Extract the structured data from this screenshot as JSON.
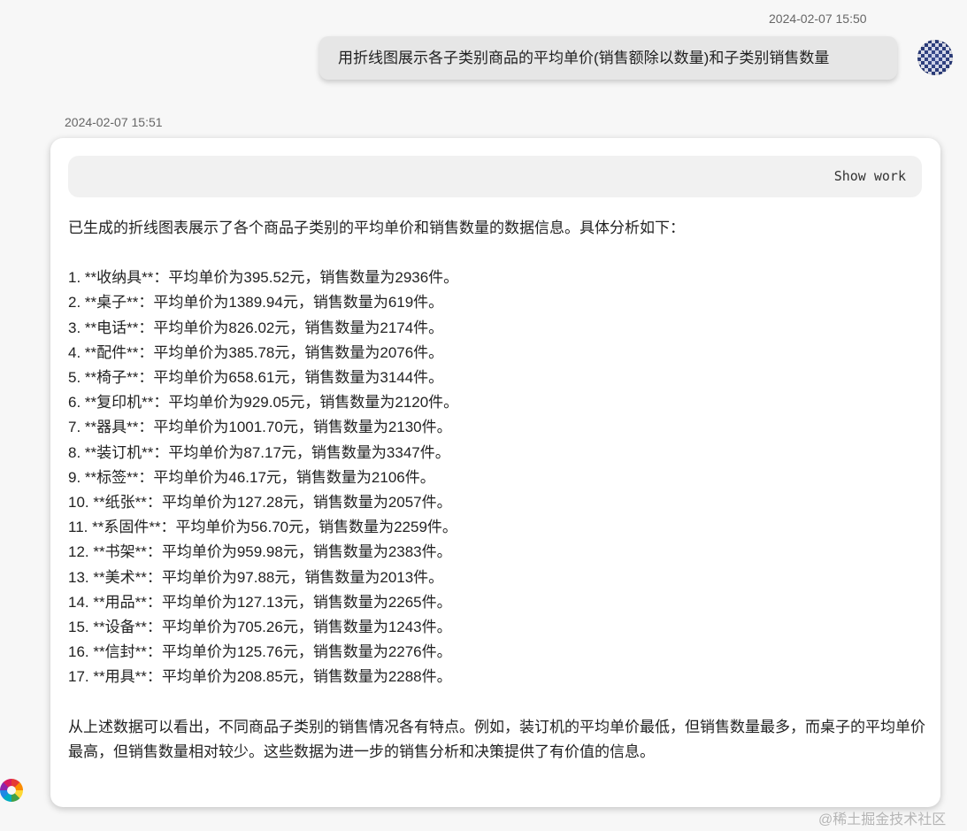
{
  "user_message": {
    "timestamp": "2024-02-07 15:50",
    "text": "用折线图展示各子类别商品的平均单价(销售额除以数量)和子类别销售数量"
  },
  "bot_message": {
    "timestamp": "2024-02-07 15:51",
    "show_work_label": "Show work",
    "intro": "已生成的折线图表展示了各个商品子类别的平均单价和销售数量的数据信息。具体分析如下：",
    "items": [
      "1. **收纳具**：平均单价为395.52元，销售数量为2936件。",
      "2. **桌子**：平均单价为1389.94元，销售数量为619件。",
      "3. **电话**：平均单价为826.02元，销售数量为2174件。",
      "4. **配件**：平均单价为385.78元，销售数量为2076件。",
      "5. **椅子**：平均单价为658.61元，销售数量为3144件。",
      "6. **复印机**：平均单价为929.05元，销售数量为2120件。",
      "7. **器具**：平均单价为1001.70元，销售数量为2130件。",
      "8. **装订机**：平均单价为87.17元，销售数量为3347件。",
      "9. **标签**：平均单价为46.17元，销售数量为2106件。",
      "10. **纸张**：平均单价为127.28元，销售数量为2057件。",
      "11. **系固件**：平均单价为56.70元，销售数量为2259件。",
      "12. **书架**：平均单价为959.98元，销售数量为2383件。",
      "13. **美术**：平均单价为97.88元，销售数量为2013件。",
      "14. **用品**：平均单价为127.13元，销售数量为2265件。",
      "15. **设备**：平均单价为705.26元，销售数量为1243件。",
      "16. **信封**：平均单价为125.76元，销售数量为2276件。",
      "17. **用具**：平均单价为208.85元，销售数量为2288件。"
    ],
    "conclusion": "从上述数据可以看出，不同商品子类别的销售情况各有特点。例如，装订机的平均单价最低，但销售数量最多，而桌子的平均单价最高，但销售数量相对较少。这些数据为进一步的销售分析和决策提供了有价值的信息。"
  },
  "icons": {
    "user_avatar": "user-avatar-icon",
    "assistant_logo": "assistant-logo-icon"
  },
  "watermark": "@稀土掘金技术社区"
}
